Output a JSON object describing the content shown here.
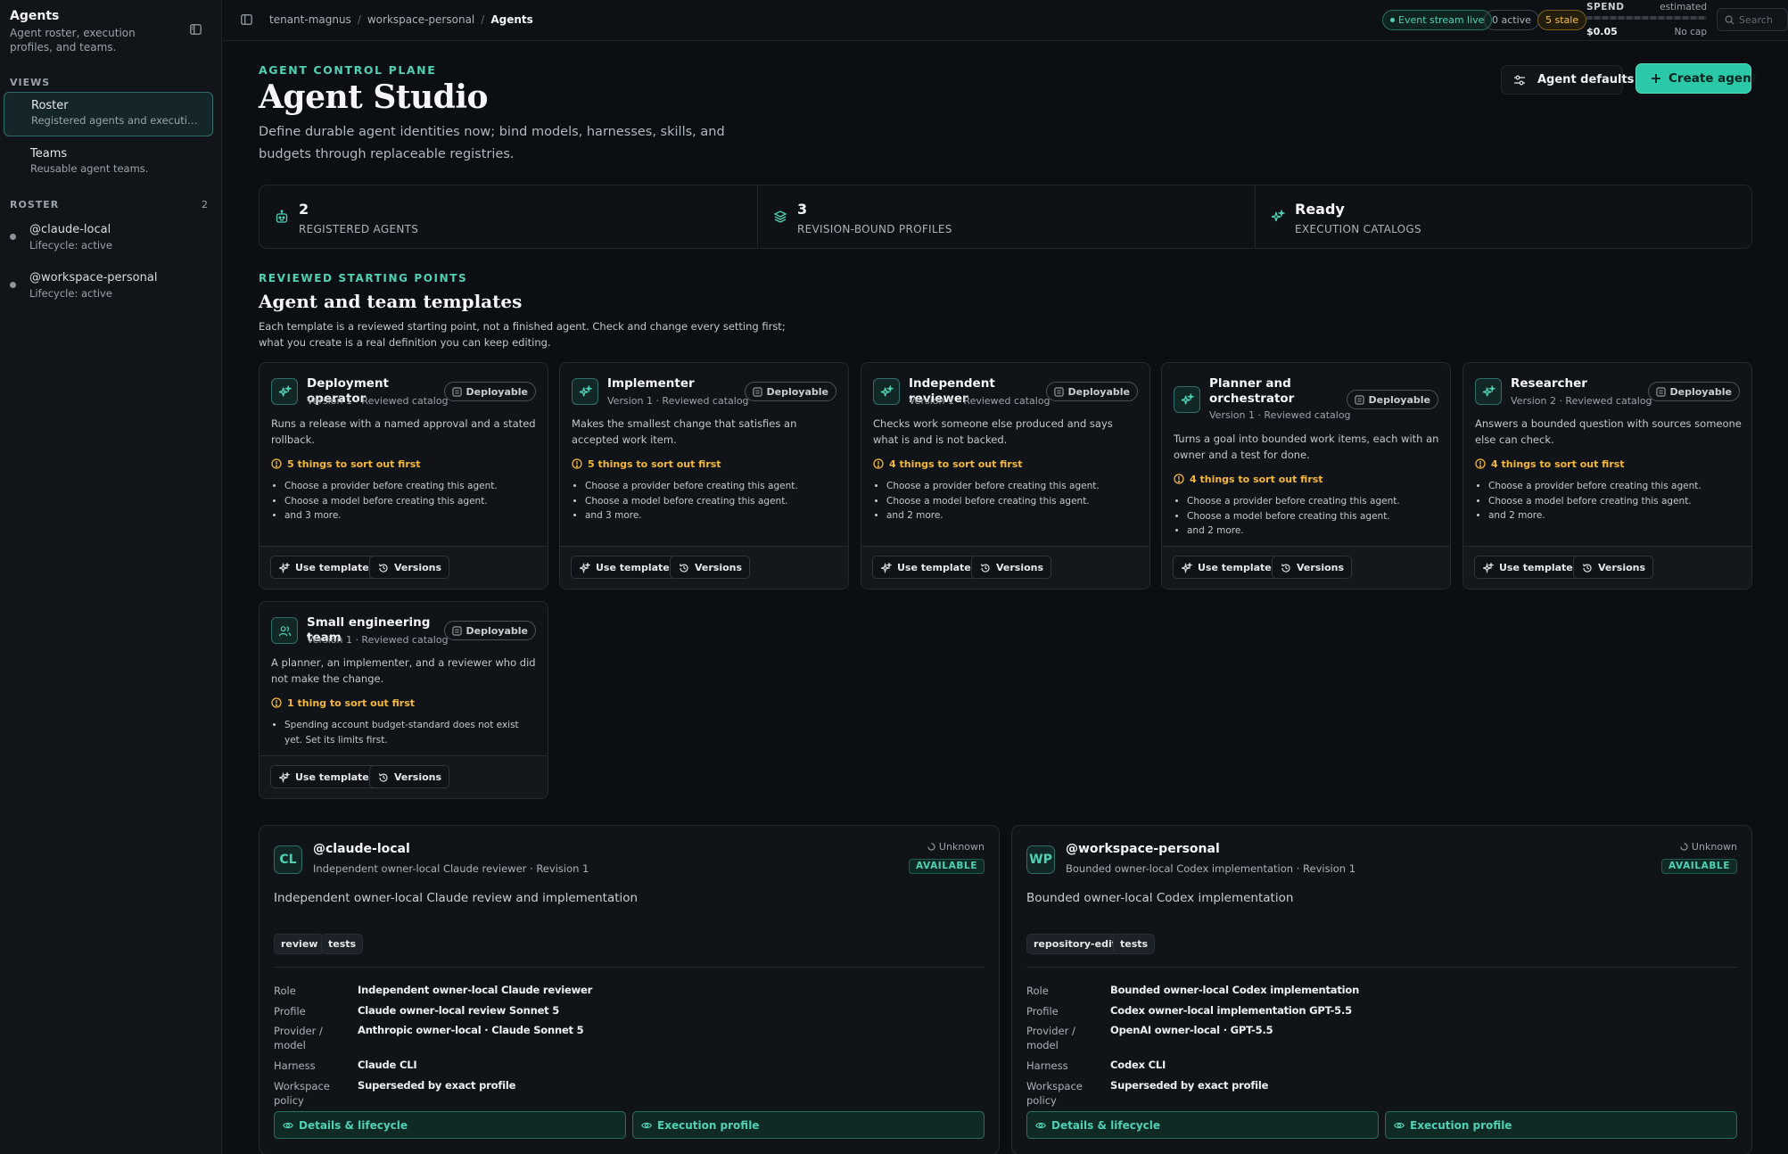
{
  "sidebar": {
    "title": "Agents",
    "subtitle": "Agent roster, execution profiles, and teams.",
    "views_label": "VIEWS",
    "views": [
      {
        "label": "Roster",
        "desc": "Registered agents and execution pr..."
      },
      {
        "label": "Teams",
        "desc": "Reusable agent teams."
      }
    ],
    "roster_label": "ROSTER",
    "roster_count": "2",
    "roster": [
      {
        "name": "@claude-local",
        "status": "Lifecycle: active"
      },
      {
        "name": "@workspace-personal",
        "status": "Lifecycle: active"
      }
    ]
  },
  "topbar": {
    "breadcrumb": [
      "tenant-magnus",
      "workspace-personal",
      "Agents"
    ],
    "event_stream": "Event stream live",
    "active": "0 active",
    "stale": "5 stale",
    "spend": {
      "label": "SPEND",
      "estimated": "estimated",
      "amount": "$0.05",
      "cap": "No cap"
    },
    "search_placeholder": "Search"
  },
  "header": {
    "eyebrow": "AGENT CONTROL PLANE",
    "title": "Agent Studio",
    "description": "Define durable agent identities now; bind models, harnesses, skills, and budgets through replaceable registries.",
    "defaults_button": "Agent defaults",
    "create_button": "Create agent"
  },
  "stats": [
    {
      "value": "2",
      "label": "REGISTERED AGENTS",
      "icon": "robot-icon"
    },
    {
      "value": "3",
      "label": "REVISION-BOUND PROFILES",
      "icon": "layers-icon"
    },
    {
      "value": "Ready",
      "label": "EXECUTION CATALOGS",
      "icon": "sparkle-icon"
    }
  ],
  "templates": {
    "eyebrow": "REVIEWED STARTING POINTS",
    "title": "Agent and team templates",
    "description": "Each template is a reviewed starting point, not a finished agent. Check and change every setting first; what you create is a real definition you can keep editing.",
    "use_label": "Use template",
    "versions_label": "Versions",
    "items": [
      {
        "name": "Deployment operator",
        "version": "Version 1 · Reviewed catalog",
        "badge": "Deployable",
        "desc": "Runs a release with a named approval and a stated rollback.",
        "warning": "5 things to sort out first",
        "bullets": [
          "Choose a provider before creating this agent.",
          "Choose a model before creating this agent.",
          "and 3 more."
        ]
      },
      {
        "name": "Implementer",
        "version": "Version 1 · Reviewed catalog",
        "badge": "Deployable",
        "desc": "Makes the smallest change that satisfies an accepted work item.",
        "warning": "5 things to sort out first",
        "bullets": [
          "Choose a provider before creating this agent.",
          "Choose a model before creating this agent.",
          "and 3 more."
        ]
      },
      {
        "name": "Independent reviewer",
        "version": "Version 1 · Reviewed catalog",
        "badge": "Deployable",
        "desc": "Checks work someone else produced and says what is and is not backed.",
        "warning": "4 things to sort out first",
        "bullets": [
          "Choose a provider before creating this agent.",
          "Choose a model before creating this agent.",
          "and 2 more."
        ]
      },
      {
        "name": "Planner and orchestrator",
        "version": "Version 1 · Reviewed catalog",
        "badge": "Deployable",
        "desc": "Turns a goal into bounded work items, each with an owner and a test for done.",
        "warning": "4 things to sort out first",
        "bullets": [
          "Choose a provider before creating this agent.",
          "Choose a model before creating this agent.",
          "and 2 more."
        ]
      },
      {
        "name": "Researcher",
        "version": "Version 2 · Reviewed catalog",
        "badge": "Deployable",
        "desc": "Answers a bounded question with sources someone else can check.",
        "warning": "4 things to sort out first",
        "bullets": [
          "Choose a provider before creating this agent.",
          "Choose a model before creating this agent.",
          "and 2 more."
        ]
      },
      {
        "name": "Small engineering team",
        "version": "Version 1 · Reviewed catalog",
        "badge": "Deployable",
        "desc": "A planner, an implementer, and a reviewer who did not make the change.",
        "warning": "1 thing to sort out first",
        "bullets": [
          "Spending account budget-standard does not exist yet. Set its limits first."
        ]
      }
    ]
  },
  "agents": [
    {
      "initials": "CL",
      "name": "@claude-local",
      "subtitle": "Independent owner-local Claude reviewer · Revision 1",
      "health": "Unknown",
      "availability": "AVAILABLE",
      "description": "Independent owner-local Claude review and implementation",
      "tags": [
        "review",
        "tests"
      ],
      "fields": [
        {
          "k": "Role",
          "v": "Independent owner-local Claude reviewer"
        },
        {
          "k": "Profile",
          "v": "Claude owner-local review Sonnet 5"
        },
        {
          "k": "Provider / model",
          "v": "Anthropic owner-local · Claude Sonnet 5"
        },
        {
          "k": "Harness",
          "v": "Claude CLI"
        },
        {
          "k": "Workspace policy",
          "v": "Superseded by exact profile"
        }
      ],
      "details_button": "Details & lifecycle",
      "profile_button": "Execution profile"
    },
    {
      "initials": "WP",
      "name": "@workspace-personal",
      "subtitle": "Bounded owner-local Codex implementation · Revision 1",
      "health": "Unknown",
      "availability": "AVAILABLE",
      "description": "Bounded owner-local Codex implementation",
      "tags": [
        "repository-edit",
        "tests"
      ],
      "fields": [
        {
          "k": "Role",
          "v": "Bounded owner-local Codex implementation"
        },
        {
          "k": "Profile",
          "v": "Codex owner-local implementation GPT-5.5"
        },
        {
          "k": "Provider / model",
          "v": "OpenAI owner-local · GPT-5.5"
        },
        {
          "k": "Harness",
          "v": "Codex CLI"
        },
        {
          "k": "Workspace policy",
          "v": "Superseded by exact profile"
        }
      ],
      "details_button": "Details & lifecycle",
      "profile_button": "Execution profile"
    }
  ],
  "colors": {
    "accent": "#2bc9a7",
    "accent_text": "#4fd1b5",
    "warning": "#f3b73b",
    "background": "#0b0e12"
  }
}
